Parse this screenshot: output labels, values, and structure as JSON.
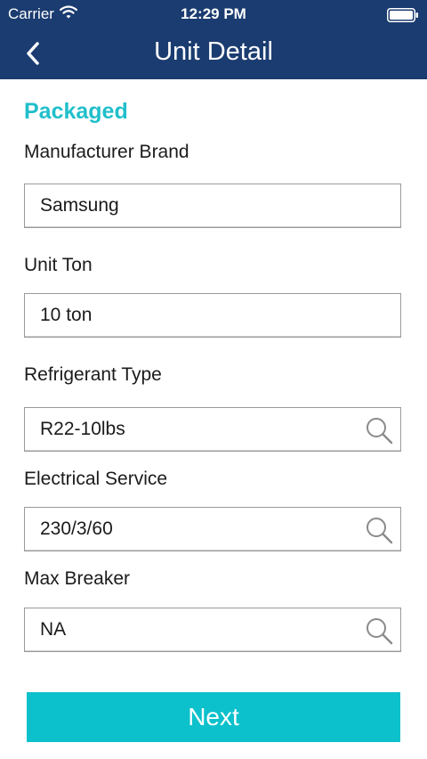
{
  "status_bar": {
    "carrier": "Carrier",
    "time": "12:29 PM",
    "icons": [
      "wifi-icon",
      "battery-icon"
    ]
  },
  "nav": {
    "title": "Unit Detail",
    "back_icon": "chevron-left-icon"
  },
  "section": {
    "title": "Packaged"
  },
  "fields": [
    {
      "label": "Manufacturer Brand",
      "value": "Samsung",
      "searchable": false
    },
    {
      "label": "Unit Ton",
      "value": "10 ton",
      "searchable": false
    },
    {
      "label": "Refrigerant Type",
      "value": "R22-10lbs",
      "searchable": true,
      "icon": "search-icon"
    },
    {
      "label": "Electrical Service",
      "value": "230/3/60",
      "searchable": true,
      "icon": "search-icon"
    },
    {
      "label": "Max Breaker",
      "value": "NA",
      "searchable": true,
      "icon": "search-icon"
    }
  ],
  "actions": {
    "next_label": "Next"
  },
  "colors": {
    "header_bg": "#1b3c70",
    "accent": "#20bfcb",
    "button_bg": "#0cc1cb"
  }
}
